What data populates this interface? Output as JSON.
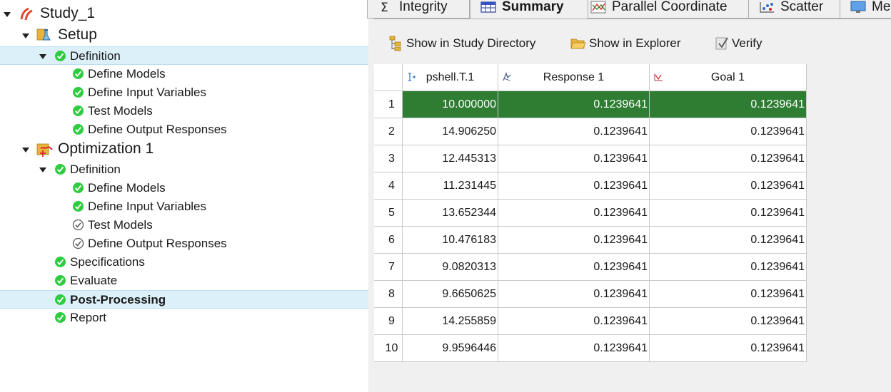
{
  "tree": {
    "items": [
      {
        "label": "Study_1",
        "level": 0,
        "expanded": true,
        "icon": "study-icon",
        "big": true
      },
      {
        "label": "Setup",
        "level": 1,
        "expanded": true,
        "icon": "setup-icon",
        "big": true
      },
      {
        "label": "Definition",
        "level": 2,
        "expanded": true,
        "icon": "check-green-icon",
        "selected": true
      },
      {
        "label": "Define Models",
        "level": 3,
        "icon": "check-green-icon"
      },
      {
        "label": "Define Input Variables",
        "level": 3,
        "icon": "check-green-icon"
      },
      {
        "label": "Test Models",
        "level": 3,
        "icon": "check-green-icon"
      },
      {
        "label": "Define Output Responses",
        "level": 3,
        "icon": "check-green-icon"
      },
      {
        "label": "Optimization 1",
        "level": 1,
        "expanded": true,
        "icon": "optimization-icon",
        "big": true
      },
      {
        "label": "Definition",
        "level": 2,
        "expanded": true,
        "icon": "check-green-icon"
      },
      {
        "label": "Define Models",
        "level": 3,
        "icon": "check-green-icon"
      },
      {
        "label": "Define Input Variables",
        "level": 3,
        "icon": "check-green-icon"
      },
      {
        "label": "Test Models",
        "level": 3,
        "icon": "check-grey-icon"
      },
      {
        "label": "Define Output Responses",
        "level": 3,
        "icon": "check-grey-icon"
      },
      {
        "label": "Specifications",
        "level": 2,
        "icon": "check-green-icon"
      },
      {
        "label": "Evaluate",
        "level": 2,
        "icon": "check-green-icon"
      },
      {
        "label": "Post-Processing",
        "level": 2,
        "icon": "check-green-icon",
        "selected": true,
        "bold": true
      },
      {
        "label": "Report",
        "level": 2,
        "icon": "check-green-icon"
      }
    ]
  },
  "tabs": [
    {
      "label": "Integrity",
      "icon": "sigma-icon"
    },
    {
      "label": "Summary",
      "icon": "table-icon",
      "active": true
    },
    {
      "label": "Parallel Coordinate",
      "icon": "parallel-coordinate-icon"
    },
    {
      "label": "Scatter",
      "icon": "scatter-icon"
    },
    {
      "label": "Me",
      "icon": "monitor-icon"
    }
  ],
  "toolbar": {
    "show_in_study_directory": "Show in Study Directory",
    "show_in_explorer": "Show in Explorer",
    "verify": "Verify"
  },
  "table": {
    "columns": [
      {
        "label": "pshell.T.1",
        "icon": "input-variable-icon"
      },
      {
        "label": "Response 1",
        "icon": "response-icon"
      },
      {
        "label": "Goal 1",
        "icon": "goal-icon"
      }
    ],
    "rows": [
      {
        "n": "1",
        "cells": [
          "10.000000",
          "0.1239641",
          "0.1239641"
        ]
      },
      {
        "n": "2",
        "cells": [
          "14.906250",
          "0.1239641",
          "0.1239641"
        ]
      },
      {
        "n": "3",
        "cells": [
          "12.445313",
          "0.1239641",
          "0.1239641"
        ]
      },
      {
        "n": "4",
        "cells": [
          "11.231445",
          "0.1239641",
          "0.1239641"
        ]
      },
      {
        "n": "5",
        "cells": [
          "13.652344",
          "0.1239641",
          "0.1239641"
        ]
      },
      {
        "n": "6",
        "cells": [
          "10.476183",
          "0.1239641",
          "0.1239641"
        ]
      },
      {
        "n": "7",
        "cells": [
          "9.0820313",
          "0.1239641",
          "0.1239641"
        ]
      },
      {
        "n": "8",
        "cells": [
          "9.6650625",
          "0.1239641",
          "0.1239641"
        ]
      },
      {
        "n": "9",
        "cells": [
          "14.255859",
          "0.1239641",
          "0.1239641"
        ]
      },
      {
        "n": "10",
        "cells": [
          "9.9596446",
          "0.1239641",
          "0.1239641"
        ]
      }
    ]
  },
  "colors": {
    "selected_row": "#2e7d32",
    "tree_selection": "#dcf0f9",
    "check_green": "#2ecc40"
  }
}
